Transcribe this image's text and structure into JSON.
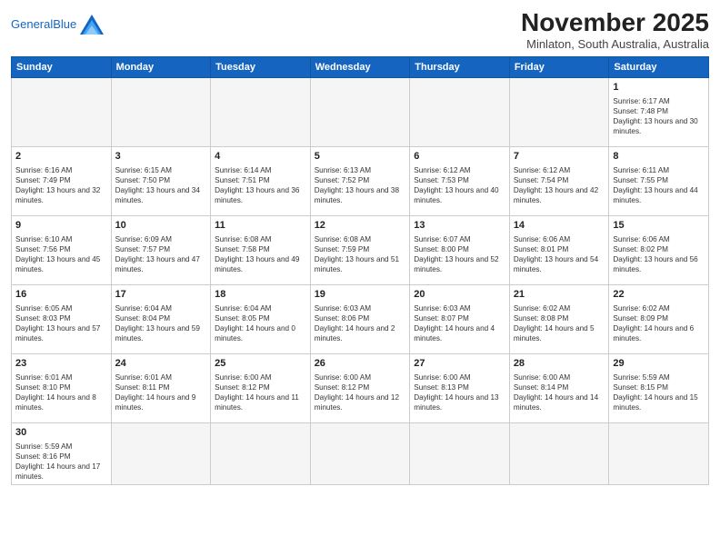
{
  "header": {
    "logo_line1": "General",
    "logo_line2": "Blue",
    "month": "November 2025",
    "location": "Minlaton, South Australia, Australia"
  },
  "days_of_week": [
    "Sunday",
    "Monday",
    "Tuesday",
    "Wednesday",
    "Thursday",
    "Friday",
    "Saturday"
  ],
  "weeks": [
    [
      {
        "day": "",
        "empty": true
      },
      {
        "day": "",
        "empty": true
      },
      {
        "day": "",
        "empty": true
      },
      {
        "day": "",
        "empty": true
      },
      {
        "day": "",
        "empty": true
      },
      {
        "day": "",
        "empty": true
      },
      {
        "day": "1",
        "sunrise": "6:17 AM",
        "sunset": "7:48 PM",
        "daylight": "13 hours and 30 minutes."
      }
    ],
    [
      {
        "day": "2",
        "sunrise": "6:16 AM",
        "sunset": "7:49 PM",
        "daylight": "13 hours and 32 minutes."
      },
      {
        "day": "3",
        "sunrise": "6:15 AM",
        "sunset": "7:50 PM",
        "daylight": "13 hours and 34 minutes."
      },
      {
        "day": "4",
        "sunrise": "6:14 AM",
        "sunset": "7:51 PM",
        "daylight": "13 hours and 36 minutes."
      },
      {
        "day": "5",
        "sunrise": "6:13 AM",
        "sunset": "7:52 PM",
        "daylight": "13 hours and 38 minutes."
      },
      {
        "day": "6",
        "sunrise": "6:12 AM",
        "sunset": "7:53 PM",
        "daylight": "13 hours and 40 minutes."
      },
      {
        "day": "7",
        "sunrise": "6:12 AM",
        "sunset": "7:54 PM",
        "daylight": "13 hours and 42 minutes."
      },
      {
        "day": "8",
        "sunrise": "6:11 AM",
        "sunset": "7:55 PM",
        "daylight": "13 hours and 44 minutes."
      }
    ],
    [
      {
        "day": "9",
        "sunrise": "6:10 AM",
        "sunset": "7:56 PM",
        "daylight": "13 hours and 45 minutes."
      },
      {
        "day": "10",
        "sunrise": "6:09 AM",
        "sunset": "7:57 PM",
        "daylight": "13 hours and 47 minutes."
      },
      {
        "day": "11",
        "sunrise": "6:08 AM",
        "sunset": "7:58 PM",
        "daylight": "13 hours and 49 minutes."
      },
      {
        "day": "12",
        "sunrise": "6:08 AM",
        "sunset": "7:59 PM",
        "daylight": "13 hours and 51 minutes."
      },
      {
        "day": "13",
        "sunrise": "6:07 AM",
        "sunset": "8:00 PM",
        "daylight": "13 hours and 52 minutes."
      },
      {
        "day": "14",
        "sunrise": "6:06 AM",
        "sunset": "8:01 PM",
        "daylight": "13 hours and 54 minutes."
      },
      {
        "day": "15",
        "sunrise": "6:06 AM",
        "sunset": "8:02 PM",
        "daylight": "13 hours and 56 minutes."
      }
    ],
    [
      {
        "day": "16",
        "sunrise": "6:05 AM",
        "sunset": "8:03 PM",
        "daylight": "13 hours and 57 minutes."
      },
      {
        "day": "17",
        "sunrise": "6:04 AM",
        "sunset": "8:04 PM",
        "daylight": "13 hours and 59 minutes."
      },
      {
        "day": "18",
        "sunrise": "6:04 AM",
        "sunset": "8:05 PM",
        "daylight": "14 hours and 0 minutes."
      },
      {
        "day": "19",
        "sunrise": "6:03 AM",
        "sunset": "8:06 PM",
        "daylight": "14 hours and 2 minutes."
      },
      {
        "day": "20",
        "sunrise": "6:03 AM",
        "sunset": "8:07 PM",
        "daylight": "14 hours and 4 minutes."
      },
      {
        "day": "21",
        "sunrise": "6:02 AM",
        "sunset": "8:08 PM",
        "daylight": "14 hours and 5 minutes."
      },
      {
        "day": "22",
        "sunrise": "6:02 AM",
        "sunset": "8:09 PM",
        "daylight": "14 hours and 6 minutes."
      }
    ],
    [
      {
        "day": "23",
        "sunrise": "6:01 AM",
        "sunset": "8:10 PM",
        "daylight": "14 hours and 8 minutes."
      },
      {
        "day": "24",
        "sunrise": "6:01 AM",
        "sunset": "8:11 PM",
        "daylight": "14 hours and 9 minutes."
      },
      {
        "day": "25",
        "sunrise": "6:00 AM",
        "sunset": "8:12 PM",
        "daylight": "14 hours and 11 minutes."
      },
      {
        "day": "26",
        "sunrise": "6:00 AM",
        "sunset": "8:12 PM",
        "daylight": "14 hours and 12 minutes."
      },
      {
        "day": "27",
        "sunrise": "6:00 AM",
        "sunset": "8:13 PM",
        "daylight": "14 hours and 13 minutes."
      },
      {
        "day": "28",
        "sunrise": "6:00 AM",
        "sunset": "8:14 PM",
        "daylight": "14 hours and 14 minutes."
      },
      {
        "day": "29",
        "sunrise": "5:59 AM",
        "sunset": "8:15 PM",
        "daylight": "14 hours and 15 minutes."
      }
    ],
    [
      {
        "day": "30",
        "sunrise": "5:59 AM",
        "sunset": "8:16 PM",
        "daylight": "14 hours and 17 minutes."
      },
      {
        "day": "",
        "empty": true
      },
      {
        "day": "",
        "empty": true
      },
      {
        "day": "",
        "empty": true
      },
      {
        "day": "",
        "empty": true
      },
      {
        "day": "",
        "empty": true
      },
      {
        "day": "",
        "empty": true
      }
    ]
  ]
}
